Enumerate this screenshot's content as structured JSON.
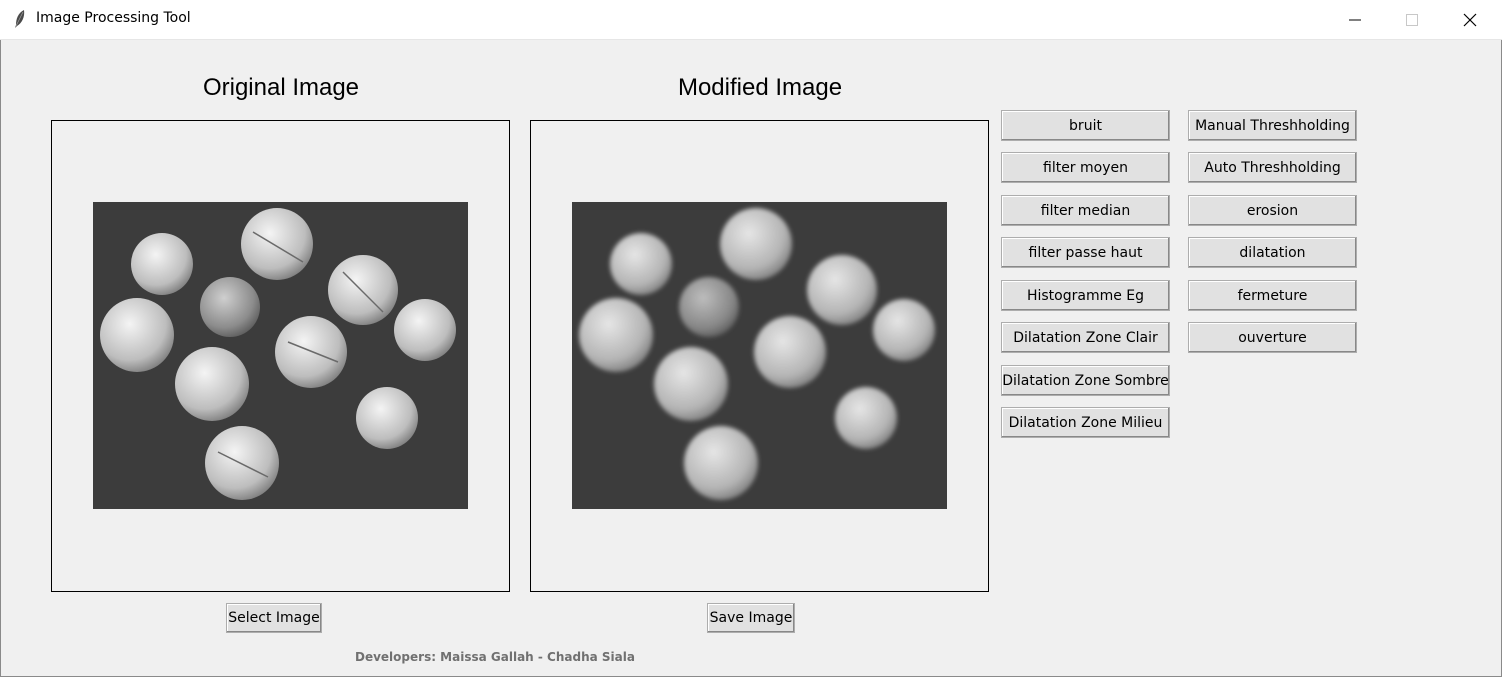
{
  "window": {
    "title": "Image Processing Tool",
    "icon": "feather-icon",
    "controls": [
      "minimize-icon",
      "maximize-icon",
      "close-icon"
    ]
  },
  "panels": {
    "original_title": "Original Image",
    "modified_title": "Modified Image"
  },
  "buttons": {
    "select_image": "Select Image",
    "save_image": "Save Image"
  },
  "operations_left": [
    "bruit",
    "filter moyen",
    "filter median",
    "filter passe haut",
    "Histogramme Eg",
    "Dilatation Zone Clair",
    "Dilatation Zone Sombre",
    "Dilatation Zone Milieu"
  ],
  "operations_right": [
    "Manual Threshholding",
    "Auto Threshholding",
    "erosion",
    "dilatation",
    "fermeture",
    "ouverture"
  ],
  "credits": "Developers: Maissa Gallah - Chadha Siala",
  "colors": {
    "background": "#f0f0f0",
    "button_face": "#e1e1e1",
    "photo_background": "#3c3c3c"
  }
}
